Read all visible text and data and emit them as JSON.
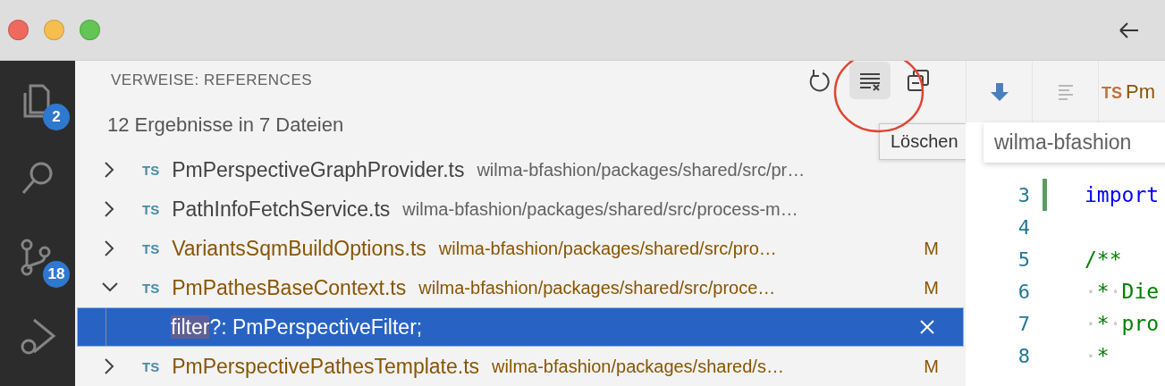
{
  "window": {
    "traffic_lights": [
      {
        "color": "#ee6a5f"
      },
      {
        "color": "#f5be4f"
      },
      {
        "color": "#62c554"
      }
    ]
  },
  "activity_bar": [
    {
      "kind": "files",
      "badge": "2"
    },
    {
      "kind": "search"
    },
    {
      "kind": "source-control",
      "badge": "18"
    },
    {
      "kind": "run-debug"
    }
  ],
  "panel": {
    "title": "VERWEISE: REFERENCES",
    "summary": "12 Ergebnisse in 7 Dateien",
    "actions": [
      {
        "kind": "refresh",
        "hovered": false
      },
      {
        "kind": "clear",
        "hovered": true
      },
      {
        "kind": "collapse",
        "hovered": false
      }
    ],
    "tooltip": "Löschen",
    "files": [
      {
        "name": "PmPerspectiveGraphProvider.ts",
        "path": "wilma-bfashion/packages/shared/src/pr…",
        "modified": false,
        "expanded": false,
        "type_label": "TS"
      },
      {
        "name": "PathInfoFetchService.ts",
        "path": "wilma-bfashion/packages/shared/src/process-m…",
        "modified": false,
        "expanded": false,
        "type_label": "TS"
      },
      {
        "name": "VariantsSqmBuildOptions.ts",
        "path": "wilma-bfashion/packages/shared/src/pro…",
        "modified": true,
        "badge": "M",
        "expanded": false,
        "type_label": "TS"
      },
      {
        "name": "PmPathesBaseContext.ts",
        "path": "wilma-bfashion/packages/shared/src/proce…",
        "modified": true,
        "badge": "M",
        "expanded": true,
        "type_label": "TS",
        "children": [
          {
            "match": "filter",
            "text": "?: PmPerspectiveFilter;",
            "selected": true
          }
        ]
      },
      {
        "name": "PmPerspectivePathesTemplate.ts",
        "path": "wilma-bfashion/packages/shared/s…",
        "modified": true,
        "badge": "M",
        "expanded": false,
        "type_label": "TS"
      }
    ]
  },
  "editor": {
    "tab": {
      "type_label": "TS",
      "name": "Pm"
    },
    "hover": "wilma-bfashion",
    "lines": [
      {
        "number": "3",
        "changed": true,
        "tokens": [
          {
            "text": "import",
            "kind": "keyword"
          }
        ]
      },
      {
        "number": "4",
        "changed": false
      },
      {
        "number": "5",
        "changed": false,
        "tokens": [
          {
            "text": "/**",
            "kind": "comment"
          }
        ]
      },
      {
        "number": "6",
        "changed": false,
        "tokens": [
          {
            "text": "·",
            "kind": "whitespace"
          },
          {
            "text": "*",
            "kind": "comment"
          },
          {
            "text": "·",
            "kind": "whitespace"
          },
          {
            "text": "Die",
            "kind": "comment"
          }
        ]
      },
      {
        "number": "7",
        "changed": false,
        "tokens": [
          {
            "text": "·",
            "kind": "whitespace"
          },
          {
            "text": "*",
            "kind": "comment"
          },
          {
            "text": "·",
            "kind": "whitespace"
          },
          {
            "text": "pro",
            "kind": "comment"
          }
        ]
      },
      {
        "number": "8",
        "changed": false,
        "tokens": [
          {
            "text": "·",
            "kind": "whitespace"
          },
          {
            "text": "*",
            "kind": "comment"
          }
        ]
      }
    ]
  }
}
